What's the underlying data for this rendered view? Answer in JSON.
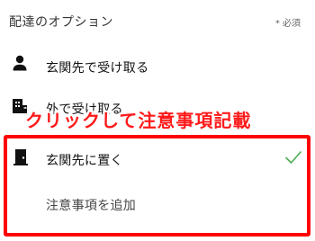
{
  "header": {
    "title": "配達のオプション",
    "required": "* 必須"
  },
  "options": [
    {
      "label": "玄関先で受け取る",
      "icon": "person-icon",
      "selected": false
    },
    {
      "label": "外で受け取る",
      "icon": "building-icon",
      "selected": false
    },
    {
      "label": "玄関先に置く",
      "icon": "door-icon",
      "selected": true
    }
  ],
  "annotation": {
    "text": "クリックして注意事項記載",
    "color": "#ff1a1a"
  },
  "add_note": {
    "label": "注意事項を追加"
  },
  "colors": {
    "check": "#4caf50",
    "highlight": "#ff0000"
  }
}
